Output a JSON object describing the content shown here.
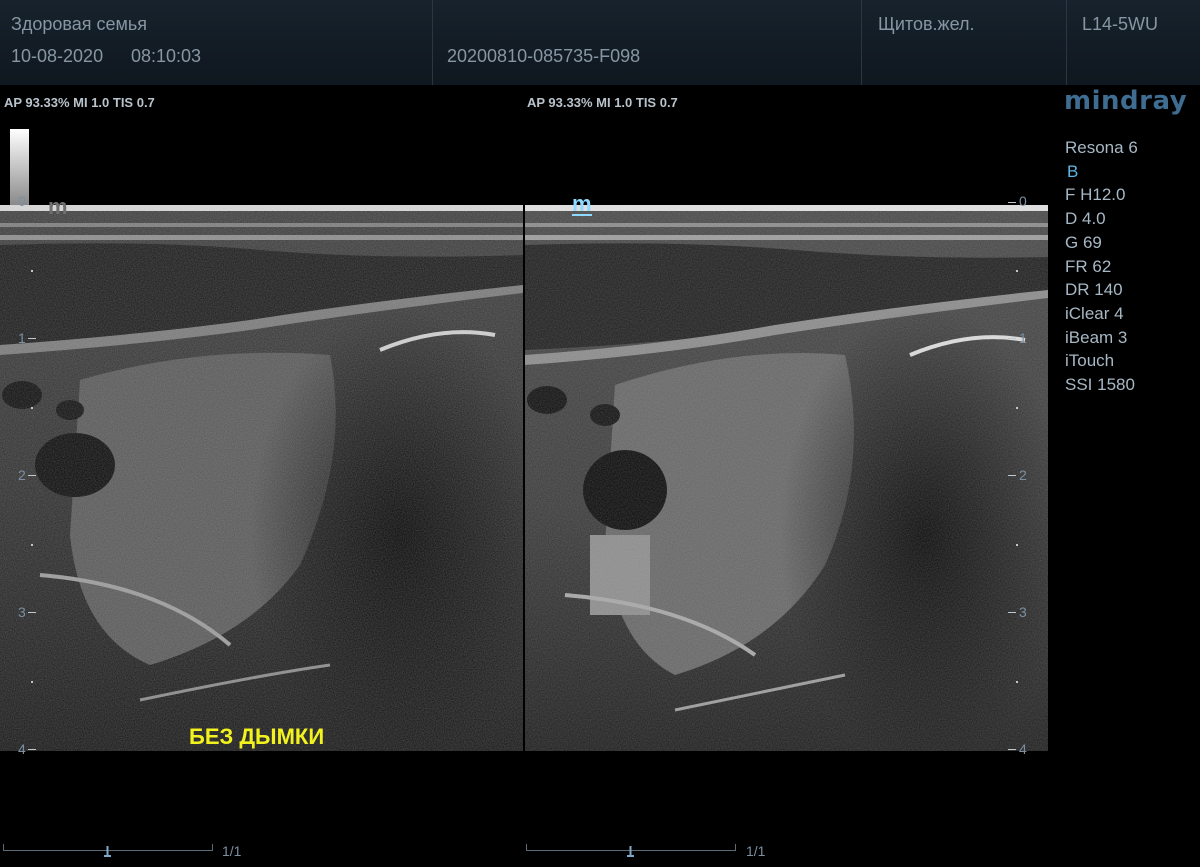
{
  "header": {
    "clinic": "Здоровая семья",
    "date": "10-08-2020",
    "time": "08:10:03",
    "study_id": "20200810-085735-F098",
    "exam": "Щитов.жел.",
    "probe": "L14-5WU"
  },
  "left_image": {
    "power_info": "AP 93.33%  MI 1.0 TIS 0.7",
    "caption": "БЕЗ ДЫМКИ",
    "cine_count": "1/1"
  },
  "right_image": {
    "power_info": "AP 93.33%  MI 1.0 TIS 0.7",
    "cine_count": "1/1"
  },
  "brand": "mindray",
  "system": {
    "model": "Resona 6",
    "mode": "B",
    "params": [
      "F H12.0",
      "D 4.0",
      "G 69",
      "FR 62",
      "DR 140",
      "iClear 4",
      "iBeam 3",
      "iTouch",
      "SSI 1580"
    ]
  },
  "depth_labels": [
    "0",
    "1",
    "2",
    "3",
    "4"
  ],
  "colors": {
    "header_text": "#8796a3",
    "caption": "#f2f21e",
    "mode_accent": "#5bb8e6",
    "brand": "#3f6d92"
  }
}
